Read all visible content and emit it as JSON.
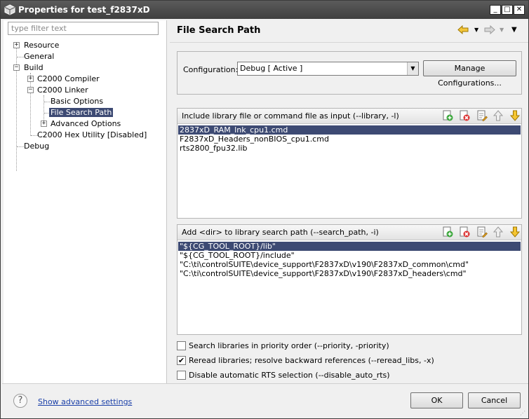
{
  "window": {
    "title": "Properties for test_f2837xD",
    "min_glyph": "_",
    "max_glyph": "□",
    "close_glyph": "✕"
  },
  "filter": {
    "placeholder": "type filter text",
    "value": ""
  },
  "tree": {
    "resource": "Resource",
    "general": "General",
    "build": "Build",
    "c2000_compiler": "C2000 Compiler",
    "c2000_linker": "C2000 Linker",
    "basic_options": "Basic Options",
    "file_search_path": "File Search Path",
    "advanced_options": "Advanced Options",
    "hex_utility": "C2000 Hex Utility  [Disabled]",
    "debug": "Debug"
  },
  "page": {
    "title": "File Search Path"
  },
  "configuration": {
    "label": "Configuration:",
    "selected": "Debug  [ Active ]",
    "manage_label": "Manage Configurations..."
  },
  "library_list": {
    "header": "Include library file or command file as input (--library, -l)",
    "items": [
      "2837xD_RAM_lnk_cpu1.cmd",
      "F2837xD_Headers_nonBIOS_cpu1.cmd",
      "rts2800_fpu32.lib"
    ],
    "selected_index": 0
  },
  "search_path_list": {
    "header": "Add <dir> to library search path (--search_path, -i)",
    "items": [
      "\"${CG_TOOL_ROOT}/lib\"",
      "\"${CG_TOOL_ROOT}/include\"",
      "\"C:\\ti\\controlSUITE\\device_support\\F2837xD\\v190\\F2837xD_common\\cmd\"",
      "\"C:\\ti\\controlSUITE\\device_support\\F2837xD\\v190\\F2837xD_headers\\cmd\""
    ],
    "selected_index": 0
  },
  "options": {
    "priority": {
      "label": "Search libraries in priority order (--priority, -priority)",
      "checked": false
    },
    "reread": {
      "label": "Reread libraries; resolve backward references (--reread_libs, -x)",
      "checked": true
    },
    "disable_rts": {
      "label": "Disable automatic RTS selection (--disable_auto_rts)",
      "checked": false
    }
  },
  "footer": {
    "help_glyph": "?",
    "advanced_link": "Show advanced settings",
    "ok_label": "OK",
    "cancel_label": "Cancel"
  },
  "icons": {
    "add": "add-icon",
    "delete": "delete-icon",
    "edit": "edit-icon",
    "move_up": "move-up-icon",
    "move_down": "move-down-icon"
  }
}
